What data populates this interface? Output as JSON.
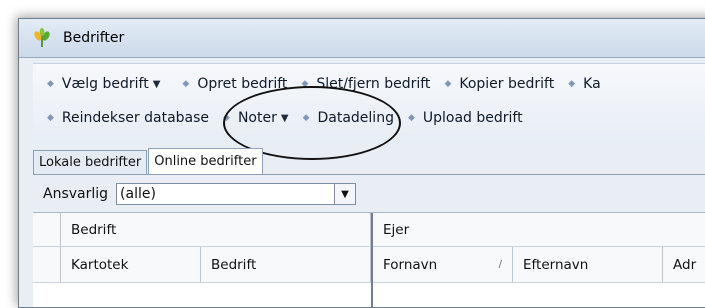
{
  "window": {
    "title": "Bedrifter"
  },
  "toolbar": {
    "row1": [
      {
        "label": "Vælg bedrift",
        "has_dropdown": true
      },
      {
        "label": "Opret bedrift",
        "has_dropdown": false
      },
      {
        "label": "Slet/fjern bedrift",
        "has_dropdown": false
      },
      {
        "label": "Kopier bedrift",
        "has_dropdown": false
      },
      {
        "label": "Ka",
        "has_dropdown": false
      }
    ],
    "row2": [
      {
        "label": "Reindekser database",
        "has_dropdown": false
      },
      {
        "label": "Noter",
        "has_dropdown": true
      },
      {
        "label": "Datadeling",
        "has_dropdown": false
      },
      {
        "label": "Upload bedrift",
        "has_dropdown": false
      }
    ]
  },
  "tabs": [
    {
      "label": "Lokale bedrifter",
      "active": false
    },
    {
      "label": "Online bedrifter",
      "active": true
    }
  ],
  "filter": {
    "label": "Ansvarlig",
    "value": "(alle)"
  },
  "grid": {
    "group_headers": [
      "Bedrift",
      "Ejer"
    ],
    "columns": [
      "Kartotek",
      "Bedrift",
      "Fornavn",
      "Efternavn",
      "Adr"
    ]
  },
  "colors": {
    "annotation": "#111111",
    "bullet": "#7f98b8",
    "window_bg": "#e9eef4"
  },
  "icons": {
    "app": "wheat-icon",
    "bullet": "bullet-icon",
    "dropdown": "chevron-down-icon"
  }
}
